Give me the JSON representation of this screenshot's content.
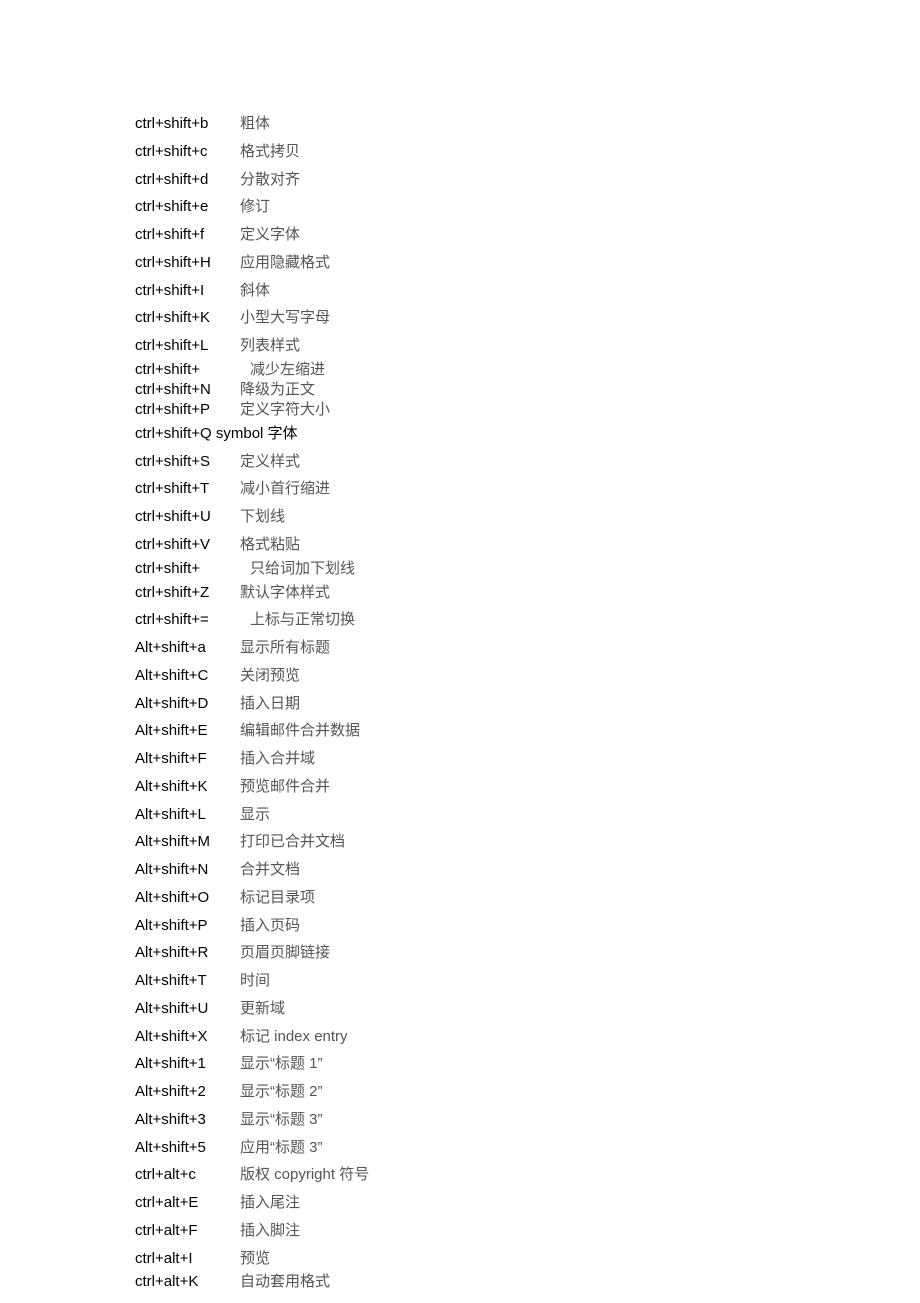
{
  "shortcuts": [
    {
      "key": "ctrl+shift+b",
      "desc": "粗体"
    },
    {
      "key": "ctrl+shift+c",
      "desc": "格式拷贝"
    },
    {
      "key": "ctrl+shift+d",
      "desc": "分散对齐"
    },
    {
      "key": "ctrl+shift+e",
      "desc": "修订"
    },
    {
      "key": "ctrl+shift+f",
      "desc": "定义字体"
    },
    {
      "key": "ctrl+shift+H",
      "desc": "应用隐藏格式"
    },
    {
      "key": "ctrl+shift+I",
      "desc": "斜体"
    },
    {
      "key": "ctrl+shift+K",
      "desc": "小型大写字母"
    },
    {
      "key": "ctrl+shift+L",
      "desc": "列表样式"
    },
    {
      "key": "ctrl+shift+",
      "desc": "减少左缩进",
      "tight": true,
      "indent": true
    },
    {
      "key": "ctrl+shift+N",
      "desc": "降级为正文",
      "tight": true
    },
    {
      "key": "ctrl+shift+P",
      "desc": "定义字符大小",
      "tight": true
    },
    {
      "key": "ctrl+shift+Q symbol 字体",
      "desc": "",
      "specialQ": true
    },
    {
      "key": "ctrl+shift+S",
      "desc": "定义样式"
    },
    {
      "key": "ctrl+shift+T",
      "desc": "减小首行缩进"
    },
    {
      "key": "ctrl+shift+U",
      "desc": "下划线"
    },
    {
      "key": "ctrl+shift+V",
      "desc": "格式粘贴"
    },
    {
      "key": "ctrl+shift+",
      "desc": "只给词加下划线",
      "tight": true,
      "indent": true
    },
    {
      "key": "ctrl+shift+Z",
      "desc": "默认字体样式"
    },
    {
      "key": "ctrl+shift+=",
      "desc": "上标与正常切换",
      "indent": true
    },
    {
      "key": "Alt+shift+a",
      "desc": "显示所有标题"
    },
    {
      "key": "Alt+shift+C",
      "desc": "关闭预览"
    },
    {
      "key": "Alt+shift+D",
      "desc": "插入日期"
    },
    {
      "key": "Alt+shift+E",
      "desc": "编辑邮件合并数据"
    },
    {
      "key": "Alt+shift+F",
      "desc": "插入合并域"
    },
    {
      "key": "Alt+shift+K",
      "desc": "预览邮件合并"
    },
    {
      "key": "Alt+shift+L",
      "desc": "显示"
    },
    {
      "key": "Alt+shift+M",
      "desc": "打印已合并文档"
    },
    {
      "key": "Alt+shift+N",
      "desc": "合并文档"
    },
    {
      "key": "Alt+shift+O",
      "desc": "标记目录项"
    },
    {
      "key": "Alt+shift+P",
      "desc": "插入页码"
    },
    {
      "key": "Alt+shift+R",
      "desc": "页眉页脚链接"
    },
    {
      "key": "Alt+shift+T",
      "desc": "时间"
    },
    {
      "key": "Alt+shift+U",
      "desc": "更新域"
    },
    {
      "key": "Alt+shift+X",
      "desc": "标记 index entry"
    },
    {
      "key": "Alt+shift+1",
      "desc": "显示“标题 1”"
    },
    {
      "key": "Alt+shift+2",
      "desc": "显示“标题 2”"
    },
    {
      "key": "Alt+shift+3",
      "desc": "显示“标题 3”"
    },
    {
      "key": "Alt+shift+5",
      "desc": "应用“标题 3”"
    },
    {
      "key": "ctrl+alt+c",
      "desc": "版权 copyright 符号"
    },
    {
      "key": "ctrl+alt+E",
      "desc": "插入尾注"
    },
    {
      "key": "ctrl+alt+F",
      "desc": "插入脚注"
    },
    {
      "key": "ctrl+alt+I",
      "desc": "预览"
    },
    {
      "key": "ctrl+alt+K",
      "desc": "自动套用格式",
      "tight": true
    }
  ]
}
